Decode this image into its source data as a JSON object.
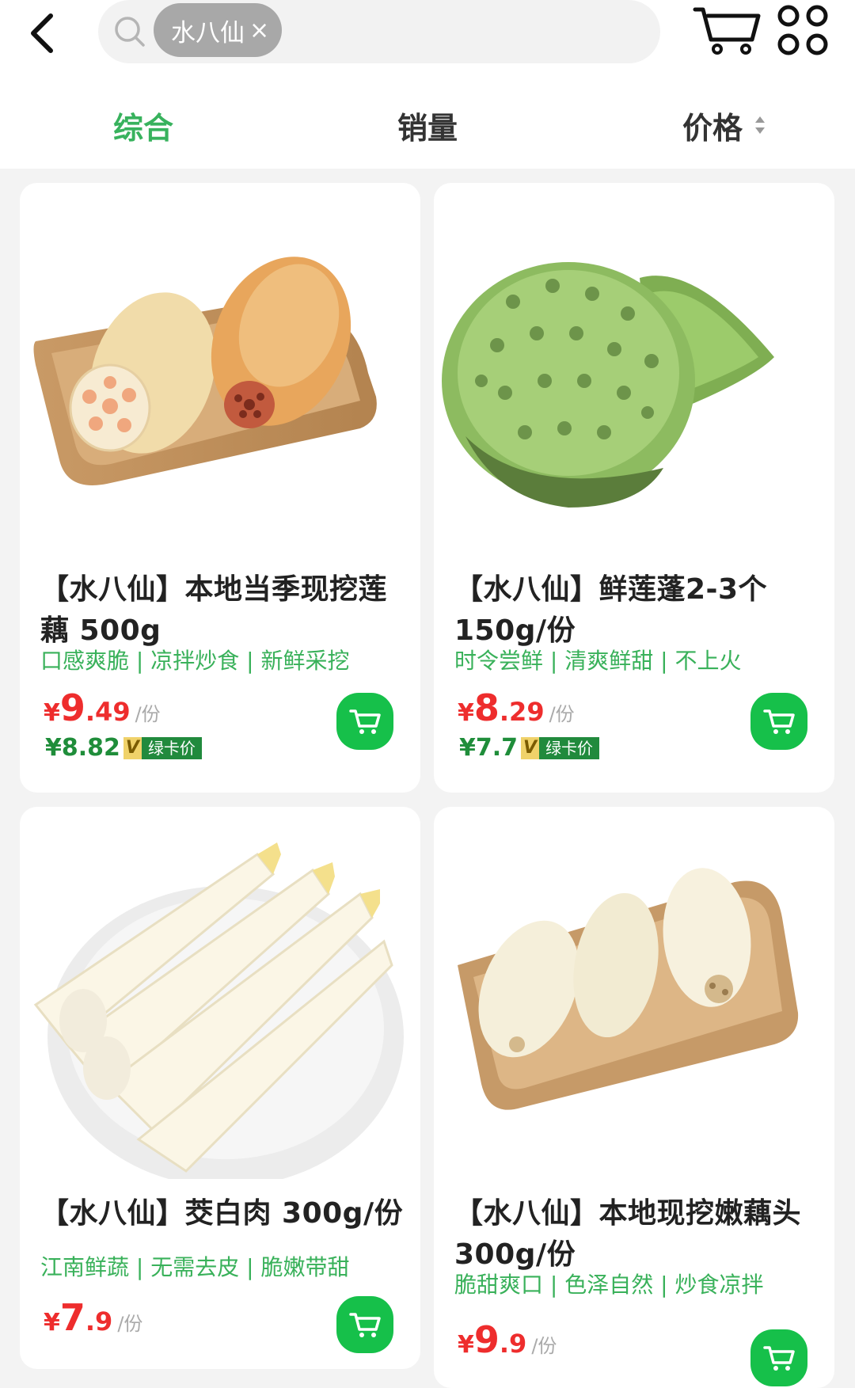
{
  "header": {
    "search_chip": "水八仙",
    "chip_close": "×"
  },
  "tabs": [
    {
      "label": "综合",
      "active": true
    },
    {
      "label": "销量",
      "active": false
    },
    {
      "label": "价格",
      "active": false
    }
  ],
  "colors": {
    "accent_green": "#38b25d",
    "price_red": "#ee2d2d",
    "cart_green": "#16c04a"
  },
  "products": [
    {
      "title": "【水八仙】本地当季现挖莲藕 500g",
      "tagline": "口感爽脆 | 凉拌炒食 | 新鲜采挖",
      "price_yen": "¥",
      "price_int": "9",
      "price_dec": ".49",
      "unit": "/份",
      "member_price": "¥8.82",
      "member_badge_v": "V",
      "member_badge": "绿卡价"
    },
    {
      "title": "【水八仙】鲜莲蓬2-3个 150g/份",
      "tagline": "时令尝鲜 | 清爽鲜甜 | 不上火",
      "price_yen": "¥",
      "price_int": "8",
      "price_dec": ".29",
      "unit": "/份",
      "member_price": "¥7.7",
      "member_badge_v": "V",
      "member_badge": "绿卡价"
    },
    {
      "title": "【水八仙】茭白肉 300g/份",
      "tagline": "江南鲜蔬 | 无需去皮 | 脆嫩带甜",
      "price_yen": "¥",
      "price_int": "7",
      "price_dec": ".9",
      "unit": "/份"
    },
    {
      "title": "【水八仙】本地现挖嫩藕头 300g/份",
      "tagline": "脆甜爽口 | 色泽自然 | 炒食凉拌",
      "price_yen": "¥",
      "price_int": "9",
      "price_dec": ".9",
      "unit": "/份"
    }
  ]
}
